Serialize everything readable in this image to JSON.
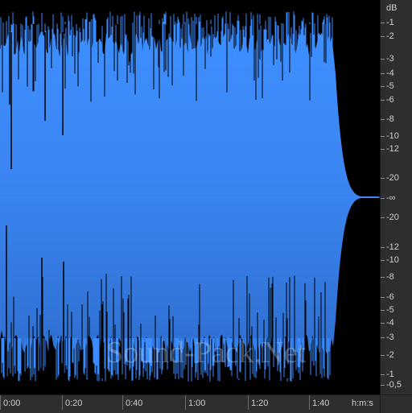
{
  "scale": {
    "unit": "dB",
    "labels": [
      "-1",
      "-2",
      "-3",
      "-4",
      "-5",
      "-6",
      "-8",
      "-10",
      "-12",
      "-20",
      "-∞",
      "-20",
      "-12",
      "-10",
      "-8",
      "-6",
      "-5",
      "-4",
      "-3",
      "-2",
      "-1",
      "-0,5"
    ]
  },
  "ruler": {
    "unit": "h:m:s",
    "labels": [
      "0:00",
      "0:20",
      "0:40",
      "1:00",
      "1:20",
      "1:40"
    ]
  },
  "waveform": {
    "color": "#3a8cff",
    "color_dark": "#2e6fcf",
    "background": "#000000",
    "audio_end_fraction": 0.88
  },
  "watermark": "Sound-Pack.Net"
}
